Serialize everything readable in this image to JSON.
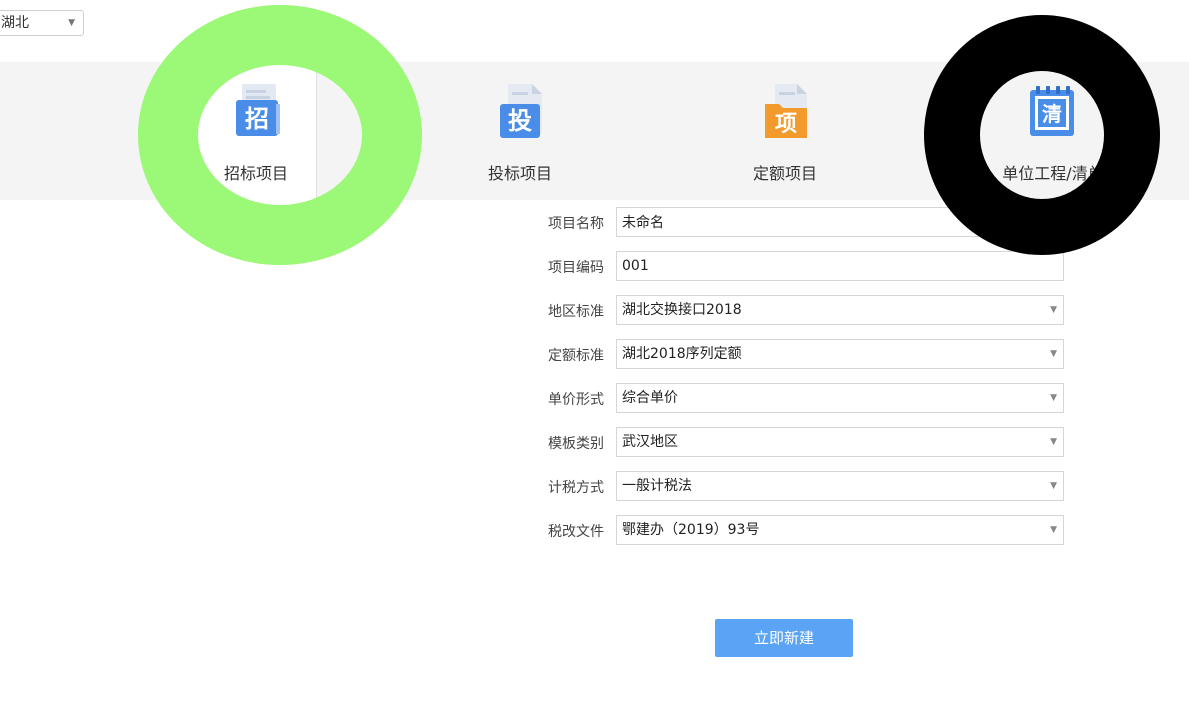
{
  "region": {
    "selected": "湖北",
    "dropdown_icon": "caret-down"
  },
  "categories": [
    {
      "label": "招标项目",
      "icon_char": "招",
      "icon_color": "#4a8de8",
      "icon_name": "tender-document-icon",
      "active": true
    },
    {
      "label": "投标项目",
      "icon_char": "投",
      "icon_color": "#4a8de8",
      "icon_name": "bid-document-icon",
      "active": false
    },
    {
      "label": "定额项目",
      "icon_char": "项",
      "icon_color": "#f39a2c",
      "icon_name": "quota-folder-icon",
      "active": false
    },
    {
      "label": "单位工程/清单",
      "icon_char": "清",
      "icon_color": "#4a8de8",
      "icon_name": "bill-notepad-icon",
      "active": false
    }
  ],
  "form": {
    "fields": [
      {
        "label": "项目名称",
        "value": "未命名",
        "type": "input"
      },
      {
        "label": "项目编码",
        "value": "001",
        "type": "input"
      },
      {
        "label": "地区标准",
        "value": "湖北交换接口2018",
        "type": "select"
      },
      {
        "label": "定额标准",
        "value": "湖北2018序列定额",
        "type": "select"
      },
      {
        "label": "单价形式",
        "value": "综合单价",
        "type": "select"
      },
      {
        "label": "模板类别",
        "value": "武汉地区",
        "type": "select"
      },
      {
        "label": "计税方式",
        "value": "一般计税法",
        "type": "select"
      },
      {
        "label": "税改文件",
        "value": "鄂建办（2019）93号",
        "type": "select"
      }
    ],
    "submit_label": "立即新建"
  },
  "colors": {
    "accent": "#5ba4f5",
    "annotation_green": "#9cf877",
    "annotation_black": "#000000"
  }
}
